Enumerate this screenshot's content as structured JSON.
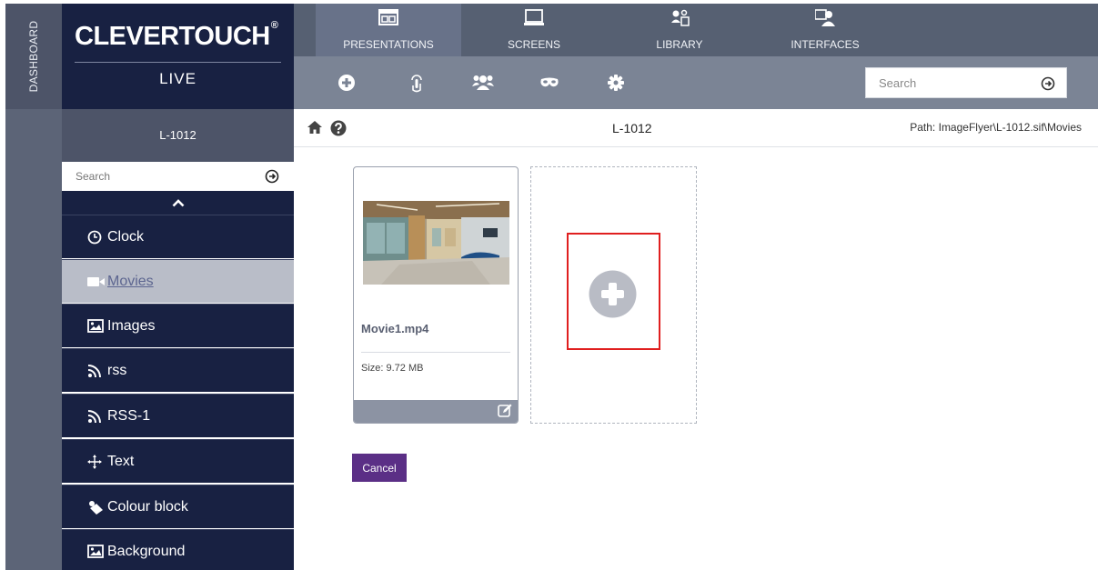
{
  "dashboard": {
    "label": "DASHBOARD"
  },
  "logo": {
    "brand": "CLEVERTOUCH",
    "registered": "®",
    "sub": "LIVE"
  },
  "tabs": [
    {
      "label": "PRESENTATIONS",
      "icon": "presentation-icon",
      "active": true
    },
    {
      "label": "SCREENS",
      "icon": "monitor-icon",
      "active": false
    },
    {
      "label": "LIBRARY",
      "icon": "library-icon",
      "active": false
    },
    {
      "label": "INTERFACES",
      "icon": "interfaces-icon",
      "active": false
    }
  ],
  "toolbar": {
    "icons": [
      "add-circle-icon",
      "touch-icon",
      "users-icon",
      "mask-icon",
      "gear-icon"
    ],
    "search": {
      "placeholder": "Search"
    }
  },
  "sidebar": {
    "header": "L-1012",
    "search": {
      "placeholder": "Search"
    },
    "items": [
      {
        "label": "Clock",
        "icon": "clock-icon"
      },
      {
        "label": "Movies",
        "icon": "video-camera-icon",
        "active": true
      },
      {
        "label": "Images",
        "icon": "image-icon"
      },
      {
        "label": "rss",
        "icon": "rss-icon"
      },
      {
        "label": "RSS-1",
        "icon": "rss-icon"
      },
      {
        "label": "Text",
        "icon": "move-arrows-icon"
      },
      {
        "label": "Colour block",
        "icon": "paint-icon"
      },
      {
        "label": "Background",
        "icon": "image-icon"
      }
    ]
  },
  "content": {
    "title": "L-1012",
    "path": "Path: ImageFlyer\\L-1012.sif\\Movies",
    "media": {
      "name": "Movie1.mp4",
      "size": "Size: 9.72 MB"
    },
    "cancel_label": "Cancel"
  },
  "colors": {
    "navy": "#182142",
    "tab_bar": "#566072",
    "toolbar": "#7b8495",
    "active_item": "#b9bdc8",
    "cancel": "#5b2f86",
    "highlight": "#e01f1f"
  }
}
